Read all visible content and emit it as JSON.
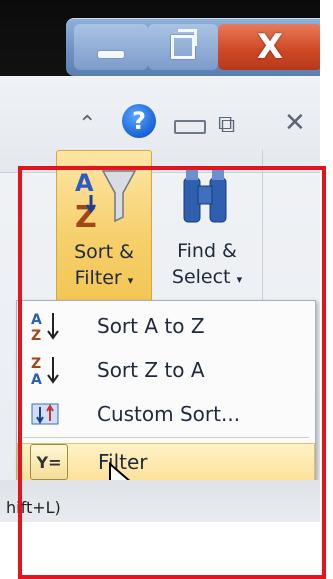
{
  "window_controls": {
    "minimize_icon": "minimize-icon",
    "restore_icon": "restore-icon",
    "close_glyph": "X"
  },
  "ribbon_controls": {
    "help_glyph": "?",
    "collapse_glyph": "⌃",
    "restore_glyph": "⧉",
    "close_glyph": "✕"
  },
  "editing_group": {
    "sort_filter": {
      "line1": "Sort &",
      "line2": "Filter",
      "caret": "▾"
    },
    "find_select": {
      "line1": "Find &",
      "line2": "Select",
      "caret": "▾"
    }
  },
  "menu": {
    "items": [
      {
        "label": "Sort A to Z",
        "icon": "sort-a-to-z-icon"
      },
      {
        "label": "Sort Z to A",
        "icon": "sort-z-to-a-icon"
      },
      {
        "label": "Custom Sort...",
        "icon": "custom-sort-icon"
      },
      {
        "label": "Filter",
        "icon": "filter-icon"
      }
    ],
    "filter_icon_text": "Y="
  },
  "below_text": "hift+L)",
  "colors": {
    "highlight": "#fde19a",
    "annotation_frame": "#e3141b"
  }
}
